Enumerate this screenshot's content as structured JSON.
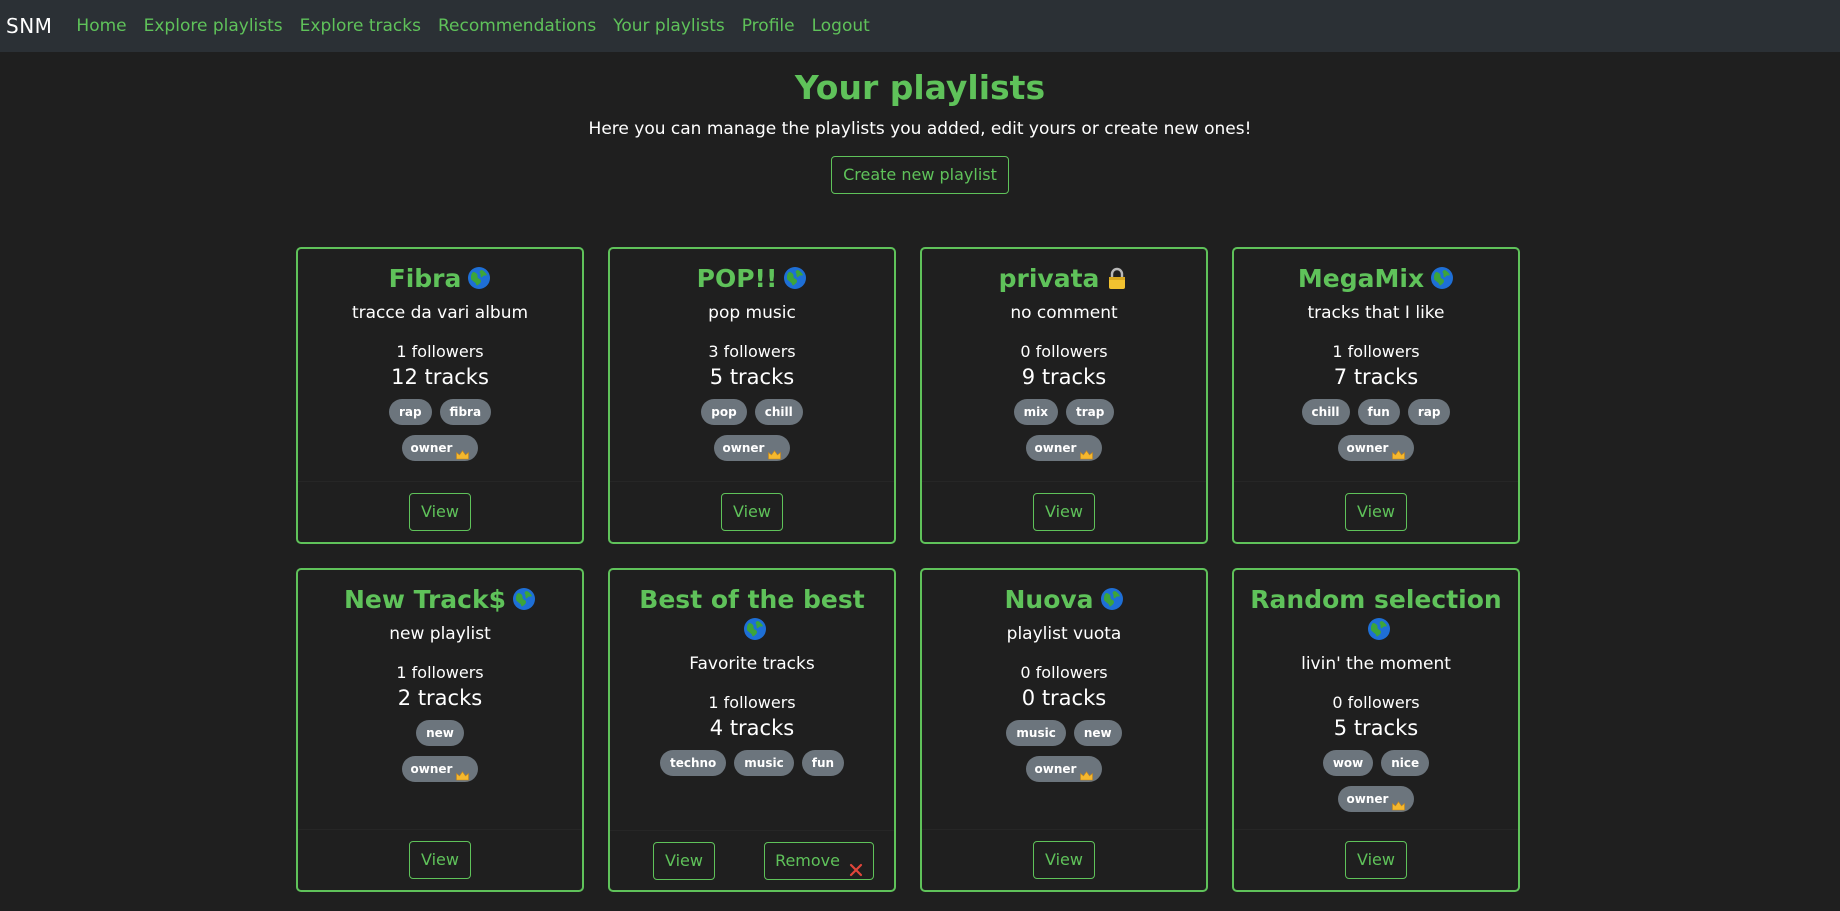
{
  "navbar": {
    "brand": "SNM",
    "links": [
      "Home",
      "Explore playlists",
      "Explore tracks",
      "Recommendations",
      "Your playlists",
      "Profile",
      "Logout"
    ]
  },
  "header": {
    "title": "Your playlists",
    "subtitle": "Here you can manage the playlists you added, edit yours or create new ones!",
    "create_label": "Create new playlist"
  },
  "colors": {
    "accent": "#5fc25a",
    "background": "#1f1f1f",
    "navbar": "#2b3035",
    "badge": "#6c757d"
  },
  "card_labels": {
    "view": "View",
    "remove": "Remove",
    "owner": "owner"
  },
  "playlists": [
    {
      "title": "Fibra",
      "visibility": "globe-icon",
      "description": "tracce da vari album",
      "followers": "1 followers",
      "tracks": "12 tracks",
      "tags": [
        "rap",
        "fibra"
      ],
      "owner": true,
      "removable": false
    },
    {
      "title": "POP!!",
      "visibility": "globe-icon",
      "description": "pop music",
      "followers": "3 followers",
      "tracks": "5 tracks",
      "tags": [
        "pop",
        "chill"
      ],
      "owner": true,
      "removable": false
    },
    {
      "title": "privata",
      "visibility": "lock-icon",
      "description": "no comment",
      "followers": "0 followers",
      "tracks": "9 tracks",
      "tags": [
        "mix",
        "trap"
      ],
      "owner": true,
      "removable": false
    },
    {
      "title": "MegaMix",
      "visibility": "globe-icon",
      "description": "tracks that I like",
      "followers": "1 followers",
      "tracks": "7 tracks",
      "tags": [
        "chill",
        "fun",
        "rap"
      ],
      "owner": true,
      "removable": false
    },
    {
      "title": "New Track$",
      "visibility": "globe-icon",
      "description": "new playlist",
      "followers": "1 followers",
      "tracks": "2 tracks",
      "tags": [
        "new"
      ],
      "owner": true,
      "removable": false
    },
    {
      "title": "Best of the best",
      "visibility": "globe-icon",
      "description": "Favorite tracks",
      "followers": "1 followers",
      "tracks": "4 tracks",
      "tags": [
        "techno",
        "music",
        "fun"
      ],
      "owner": false,
      "removable": true
    },
    {
      "title": "Nuova",
      "visibility": "globe-icon",
      "description": "playlist vuota",
      "followers": "0 followers",
      "tracks": "0 tracks",
      "tags": [
        "music",
        "new"
      ],
      "owner": true,
      "removable": false
    },
    {
      "title": "Random selection",
      "visibility": "globe-icon",
      "description": "livin' the moment",
      "followers": "0 followers",
      "tracks": "5 tracks",
      "tags": [
        "wow",
        "nice"
      ],
      "owner": true,
      "removable": false
    }
  ]
}
